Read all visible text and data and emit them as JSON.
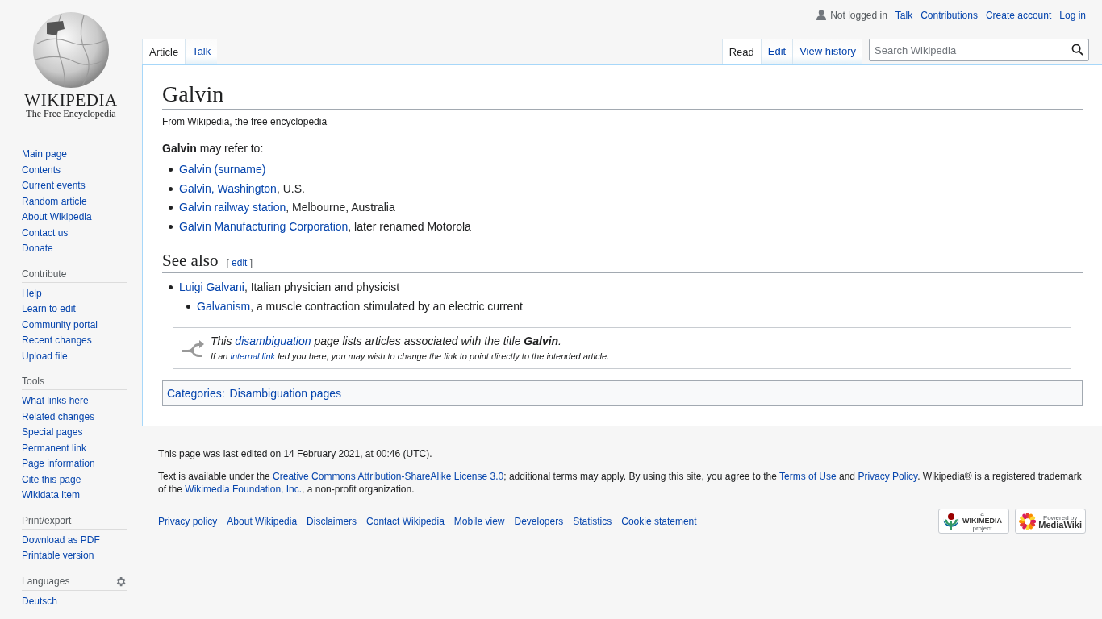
{
  "logo": {
    "wordmark": "WIKIPEDIA",
    "tagline": "The Free Encyclopedia"
  },
  "personal": {
    "status": "Not logged in",
    "links": [
      "Talk",
      "Contributions",
      "Create account",
      "Log in"
    ]
  },
  "left_tabs": [
    {
      "label": "Article",
      "selected": true
    },
    {
      "label": "Talk",
      "selected": false
    }
  ],
  "right_tabs": [
    {
      "label": "Read",
      "selected": true
    },
    {
      "label": "Edit",
      "selected": false
    },
    {
      "label": "View history",
      "selected": false
    }
  ],
  "search": {
    "placeholder": "Search Wikipedia"
  },
  "sidebar": [
    {
      "items": [
        "Main page",
        "Contents",
        "Current events",
        "Random article",
        "About Wikipedia",
        "Contact us",
        "Donate"
      ]
    },
    {
      "heading": "Contribute",
      "items": [
        "Help",
        "Learn to edit",
        "Community portal",
        "Recent changes",
        "Upload file"
      ]
    },
    {
      "heading": "Tools",
      "items": [
        "What links here",
        "Related changes",
        "Special pages",
        "Permanent link",
        "Page information",
        "Cite this page",
        "Wikidata item"
      ]
    },
    {
      "heading": "Print/export",
      "items": [
        "Download as PDF",
        "Printable version"
      ]
    },
    {
      "heading": "Languages",
      "settings": true,
      "items": [
        "Deutsch"
      ]
    }
  ],
  "article": {
    "title": "Galvin",
    "tagline": "From Wikipedia, the free encyclopedia",
    "intro": "**Galvin** may refer to:",
    "items": [
      {
        "link": "Galvin (surname)"
      },
      {
        "link": "Galvin, Washington",
        "rest": ", U.S."
      },
      {
        "link": "Galvin railway station",
        "rest": ", Melbourne, Australia"
      },
      {
        "link": "Galvin Manufacturing Corporation",
        "rest": ", later renamed Motorola"
      }
    ],
    "see_also": {
      "heading": "See also",
      "edit_section": [
        {
          "text": "[ "
        },
        {
          "text": "edit",
          "link": true
        },
        {
          "text": " ]"
        }
      ],
      "items": [
        {
          "link": "Luigi Galvani",
          "rest": ", Italian physician and physicist",
          "children": [
            {
              "link": "Galvanism",
              "rest": ", a muscle contraction stimulated by an electric current"
            }
          ]
        }
      ]
    },
    "hatnote": {
      "line1": [
        {
          "text": "This "
        },
        {
          "text": "disambiguation",
          "link": true
        },
        {
          "text": " page lists articles associated with the title **Galvin**."
        }
      ],
      "line2": [
        {
          "text": "If an "
        },
        {
          "text": "internal link",
          "link": true
        },
        {
          "text": " led you here, you may wish to change the link to point directly to the intended article."
        }
      ]
    },
    "categories": {
      "label": "Categories:",
      "items": [
        "Disambiguation pages"
      ]
    }
  },
  "footer": {
    "last_edited": "This page was last edited on 14 February 2021, at 00:46 (UTC).",
    "license": [
      {
        "text": "Text is available under the "
      },
      {
        "text": "Creative Commons Attribution-ShareAlike License 3.0",
        "link": true
      },
      {
        "text": "; additional terms may apply. By using this site, you agree to the "
      },
      {
        "text": "Terms of Use",
        "link": true
      },
      {
        "text": " and "
      },
      {
        "text": "Privacy Policy",
        "link": true
      },
      {
        "text": ". Wikipedia® is a registered trademark of the "
      },
      {
        "text": "Wikimedia Foundation, Inc.",
        "link": true
      },
      {
        "text": ", a non-profit organization."
      }
    ],
    "links": [
      "Privacy policy",
      "About Wikipedia",
      "Disclaimers",
      "Contact Wikipedia",
      "Mobile view",
      "Developers",
      "Statistics",
      "Cookie statement"
    ],
    "badges": [
      {
        "kind": "wikimedia",
        "small": "a",
        "big": "WIKIMEDIA",
        "sub": "project"
      },
      {
        "kind": "mediawiki",
        "small": "Powered by",
        "big": "MediaWiki"
      }
    ]
  }
}
